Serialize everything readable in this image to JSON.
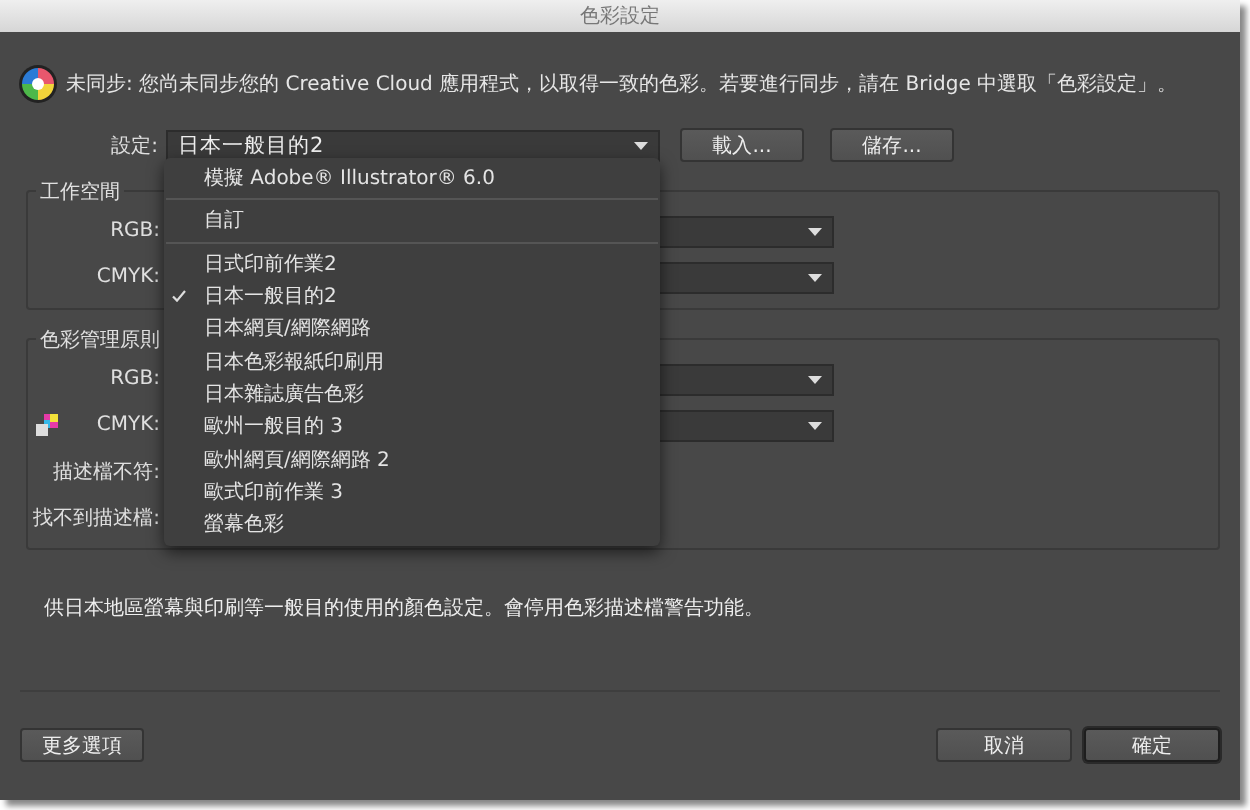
{
  "window": {
    "title": "色彩設定"
  },
  "sync_notice": "未同步: 您尚未同步您的 Creative Cloud 應用程式，以取得一致的色彩。若要進行同步，請在 Bridge 中選取「色彩設定」。",
  "settings": {
    "label": "設定:",
    "value": "日本一般目的2",
    "buttons": [
      "載入...",
      "儲存..."
    ]
  },
  "menu": {
    "sections": [
      {
        "items": [
          {
            "label": "模擬 Adobe® Illustrator® 6.0",
            "checked": false
          }
        ]
      },
      {
        "items": [
          {
            "label": "自訂",
            "checked": false
          }
        ]
      },
      {
        "items": [
          {
            "label": "日式印前作業2",
            "checked": false
          },
          {
            "label": "日本一般目的2",
            "checked": true
          },
          {
            "label": "日本網頁/網際網路",
            "checked": false
          },
          {
            "label": "日本色彩報紙印刷用",
            "checked": false
          },
          {
            "label": "日本雜誌廣告色彩",
            "checked": false
          },
          {
            "label": "歐州一般目的 3",
            "checked": false
          },
          {
            "label": "歐州網頁/網際網路 2",
            "checked": false
          },
          {
            "label": "歐式印前作業 3",
            "checked": false
          },
          {
            "label": "螢幕色彩",
            "checked": false
          }
        ]
      }
    ]
  },
  "working_space": {
    "title": "工作空間",
    "rows": [
      {
        "label": "RGB:",
        "kind": "select"
      },
      {
        "label": "CMYK:",
        "kind": "select"
      }
    ]
  },
  "color_management": {
    "title": "色彩管理原則",
    "rows": [
      {
        "label": "RGB:",
        "kind": "select"
      },
      {
        "label": "CMYK:",
        "kind": "select-icon"
      },
      {
        "label": "描述檔不符:",
        "kind": "plain"
      },
      {
        "label": "找不到描述檔:",
        "kind": "plain"
      }
    ]
  },
  "description": "供日本地區螢幕與印刷等一般目的使用的顏色設定。會停用色彩描述檔警告功能。",
  "footer": {
    "left": [
      {
        "label": "更多選項",
        "default": false
      }
    ],
    "right": [
      {
        "label": "取消",
        "default": false
      },
      {
        "label": "確定",
        "default": true
      }
    ]
  }
}
